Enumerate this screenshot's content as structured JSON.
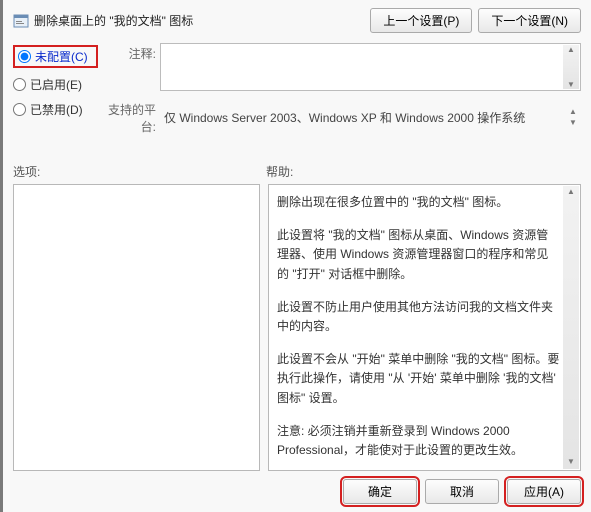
{
  "header": {
    "title": "删除桌面上的 \"我的文档\" 图标",
    "prev_button": "上一个设置(P)",
    "next_button": "下一个设置(N)"
  },
  "radio": {
    "not_configured": "未配置(C)",
    "enabled": "已启用(E)",
    "disabled": "已禁用(D)"
  },
  "labels": {
    "comment": "注释:",
    "platform": "支持的平台:",
    "options": "选项:",
    "help": "帮助:"
  },
  "platform_text": "仅 Windows Server 2003、Windows XP 和 Windows 2000 操作系统",
  "help_paragraphs": [
    "删除出现在很多位置中的 \"我的文档\" 图标。",
    "此设置将 \"我的文档\" 图标从桌面、Windows 资源管理器、使用 Windows 资源管理器窗口的程序和常见的 \"打开\" 对话框中删除。",
    "此设置不防止用户使用其他方法访问我的文档文件夹中的内容。",
    "此设置不会从 \"开始\" 菜单中删除 \"我的文档\" 图标。要执行此操作，请使用 \"从 '开始' 菜单中删除 '我的文档' 图标\" 设置。",
    "注意: 必须注销并重新登录到 Windows 2000 Professional，才能使对于此设置的更改生效。"
  ],
  "footer": {
    "ok": "确定",
    "cancel": "取消",
    "apply": "应用(A)"
  }
}
